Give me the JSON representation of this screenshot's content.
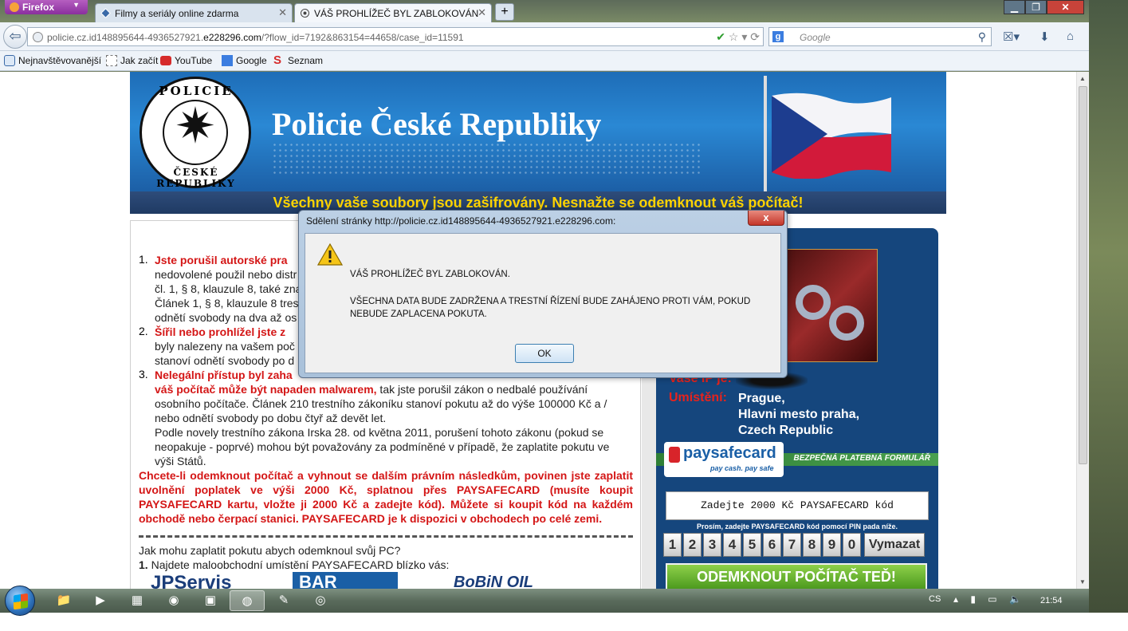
{
  "browser": {
    "menu_label": "Firefox",
    "tabs": [
      {
        "title": "Filmy a seriály online zdarma"
      },
      {
        "title": "VÁŠ PROHLÍŽEČ BYL ZABLOKOVÁN"
      }
    ],
    "new_tab": "+",
    "url_host_prefix": "policie.cz.id148895644-4936527921.",
    "url_host_domain": "e228296.com",
    "url_path": "/?flow_id=7192&863154=44658/case_id=11591",
    "search_placeholder": "Google",
    "bookmarks": [
      "Nejnavštěvovanější",
      "Jak začít",
      "YouTube",
      "Google",
      "Seznam"
    ]
  },
  "page": {
    "banner_title": "Policie České Republiky",
    "badge_top": "POLICIE",
    "badge_bottom": "ČESKÉ REPUBLIKY",
    "warning": "Všechny vaše soubory jsou zašifrovány. Nesnažte se odemknout váš počítač!",
    "items": [
      {
        "num": "1.",
        "red": "Jste porušil autorské pra",
        "lines": [
          "nedovolené použil nebo distr",
          "čl. 1, § 8, klauzule 8, také zna",
          "Článek 1, § 8, klauzule 8 tres",
          "odnětí svobody na dva až os"
        ]
      },
      {
        "num": "2.",
        "red": "Šířil nebo prohlížel jste z",
        "lines": [
          "byly nalezeny na vašem poč",
          "stanoví odnětí svobody po d"
        ]
      },
      {
        "num": "3.",
        "red": "Nelegální přístup byl zaha",
        "red2": "váš počítač může být napaden malwarem,",
        "line2_rest": " tak jste porušil zákon o nedbalé používání",
        "lines": [
          "osobního počítače. Článek 210 trestního zákoníku stanoví pokutu až do výše 100000 Kč a /",
          "nebo odnětí svobody po dobu čtyř až devět let.",
          "Podle novely trestního zákona Irska 28. od května 2011, porušení tohoto zákonu (pokud se",
          "neopakuje - poprvé) mohou být považovány za podmíněné v případě, že zaplatite pokutu ve",
          "výši Států."
        ]
      }
    ],
    "red_paragraph": "Chcete-li odemknout počítač a vyhnout se dalším právním následkům, povinen jste zaplatit uvolnění poplatek ve výši 2000 Kč, splatnou přes PAYSAFECARD (musíte koupit PAYSAFECARD kartu, vložte ji 2000 Kč a zadejte kód). Můžete si koupit kód na každém obchodě nebo čerpací stanici. PAYSAFECARD je k dispozici v obchodech po celé zemi.",
    "how_to_pay": "Jak mohu zaplatit pokutu abych odemknoul svůj PC?",
    "step1_num": "1.",
    "step1": " Najdete maloobchodní umístění PAYSAFECARD blízko vás:",
    "logos": [
      "JPServis",
      "BAR",
      "BoBiN OIL"
    ],
    "ip_label": "Vaše IP je:",
    "location_label": "Umístění:",
    "location_lines": [
      "Prague,",
      "Hlavni mesto praha,",
      "Czech Republic"
    ],
    "psc_brand": "paysafecard",
    "psc_tagline": "pay cash. pay safe",
    "psc_form_label": "BEZPEČNÁ PLATEBNÁ FORMULÁŘ",
    "code_placeholder": "Zadejte 2000 Kč PAYSAFECARD kód",
    "pin_hint": "Prosím, zadejte PAYSAFECARD kód pomocí PIN pada níže.",
    "keys": [
      "1",
      "2",
      "3",
      "4",
      "5",
      "6",
      "7",
      "8",
      "9",
      "0"
    ],
    "clear_key": "Vymazat",
    "unlock_button": "ODEMKNOUT POČÍTAČ TEĎ!"
  },
  "dialog": {
    "title": "Sdělení stránky http://policie.cz.id148895644-4936527921.e228296.com:",
    "close": "x",
    "line1": "VÁŠ PROHLÍŽEČ BYL ZABLOKOVÁN.",
    "line2": "VŠECHNA DATA BUDE ZADRŽENA A TRESTNÍ ŘÍZENÍ BUDE ZAHÁJENO PROTI VÁM, POKUD NEBUDE ZAPLACENA POKUTA.",
    "ok": "OK"
  },
  "taskbar": {
    "lang": "CS",
    "clock": "21:54"
  },
  "colors": {
    "accent_red": "#d41616",
    "banner_blue": "#2a88d4",
    "warning_yellow": "#ffd400",
    "panel_navy": "#15467d",
    "unlock_green": "#4c9a1e"
  }
}
